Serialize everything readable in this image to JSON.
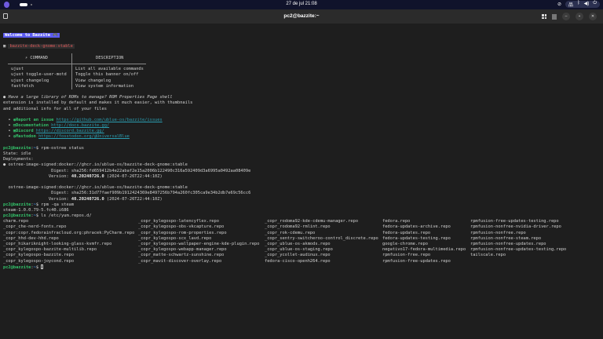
{
  "topbar": {
    "clock": "27 de jul  21:08"
  },
  "window": {
    "title": "pc2@bazzite:~"
  },
  "motd": {
    "welcome": "Welcome to Bazzite 🎮",
    "image": "bazzite-deck-gnome:stable",
    "table": {
      "col1": "⚡ COMMAND",
      "col2": "DESCRIPTION",
      "rows": [
        {
          "cmd": "ujust",
          "desc": "List all available commands"
        },
        {
          "cmd": "ujust toggle-user-motd",
          "desc": "Toggle this banner on/off"
        },
        {
          "cmd": "ujust changelog",
          "desc": "View changelog"
        },
        {
          "cmd": "fastfetch",
          "desc": "View system information"
        }
      ]
    },
    "tip": [
      "Have a large library of ROMs to manage? ROM Properties Page shell",
      "extension is installed by default and makes it much easier, with thumbnails",
      "and additional info for all of your files"
    ],
    "links": [
      {
        "label": "Report an issue",
        "url": "https://github.com/ublue-os/bazzite/issues"
      },
      {
        "label": "Documentation",
        "url": "http://docs.bazzite.gg/"
      },
      {
        "label": "Discord",
        "url": "https://discord.bazzite.gg/"
      },
      {
        "label": "Mastodon",
        "url": "https://fosstodon.org/@UniversalBlue"
      }
    ]
  },
  "prompt": {
    "user": "pc2@bazzite",
    "path": "~"
  },
  "cmd1": "rpm-ostree status",
  "status": {
    "state": "State: idle",
    "deployments": "Deployments:",
    "d1": {
      "image": "ostree-image-signed:docker://ghcr.io/ublue-os/bazzite-deck-gnome:stable",
      "digest": "sha256:fd659412b4e22abaf2e15a2006b122490c316a592409d3a6995a0492aa08409e",
      "version": "40.20240726.0",
      "date": "(2024-07-26T22:44:10Z)"
    },
    "d2": {
      "image": "ostree-image-signed:docker://ghcr.io/ublue-os/bazzite-deck-gnome:stable",
      "digest": "sha256:31d77faef909b1912424369e8497256b794a260fc305ca9e34b2db7e69c56cc6",
      "version": "40.20240726.0",
      "date": "(2024-07-26T22:44:10Z)"
    }
  },
  "cmd2": "rpm -qa steam",
  "steam": "steam-1.0.0.79-5.fc40.i686",
  "cmd3": "ls /etc/yum.repos.d/",
  "repos": [
    [
      "charm.repo",
      "_copr_kylegospo-latencyflex.repo",
      "_copr_rodoma92-kde-cdemu-manager.repo",
      "fedora.repo",
      "rpmfusion-free-updates-testing.repo"
    ],
    [
      "_copr_che-nerd-fonts.repo",
      "_copr_kylegospo-obs-vkcapture.repo",
      "_copr_rodoma92-rmlint.repo",
      "fedora-updates-archive.repo",
      "rpmfusion-nonfree-nvidia-driver.repo"
    ],
    [
      "_copr:copr.fedorainfracloud.org:phracek:PyCharm.repo",
      "_copr_kylegospo-rom-properties.repo",
      "_copr_rok-cdemu.repo",
      "fedora-updates.repo",
      "rpmfusion-nonfree.repo"
    ],
    [
      "_copr_hhd-dev-hhd.repo",
      "_copr_kylegospo-scx_lavd.repo",
      "_copr_sentry-switcheroo-control_discrete.repo",
      "fedora-updates-testing.repo",
      "rpmfusion-nonfree-steam.repo"
    ],
    [
      "_copr_hikariknight-looking-glass-kvmfr.repo",
      "_copr_kylegospo-wallpaper-engine-kde-plugin.repo",
      "_copr_ublue-os-akmods.repo",
      "google-chrome.repo",
      "rpmfusion-nonfree-updates.repo"
    ],
    [
      "_copr_kylegospo-bazzite-multilib.repo",
      "_copr_kylegospo-webapp-manager.repo",
      "_copr_ublue-os-staging.repo",
      "negativo17-fedora-multimedia.repo",
      "rpmfusion-nonfree-updates-testing.repo"
    ],
    [
      "_copr_kylegospo-bazzite.repo",
      "_copr_matte-schwartz-sunshine.repo",
      "_copr_ycollet-audinux.repo",
      "rpmfusion-free.repo",
      "tailscale.repo"
    ],
    [
      "_copr_kylegospo-joycond.repo",
      "_copr_mavit-discover-overlay.repo",
      "fedora-cisco-openh264.repo",
      "rpmfusion-free-updates.repo",
      ""
    ]
  ]
}
